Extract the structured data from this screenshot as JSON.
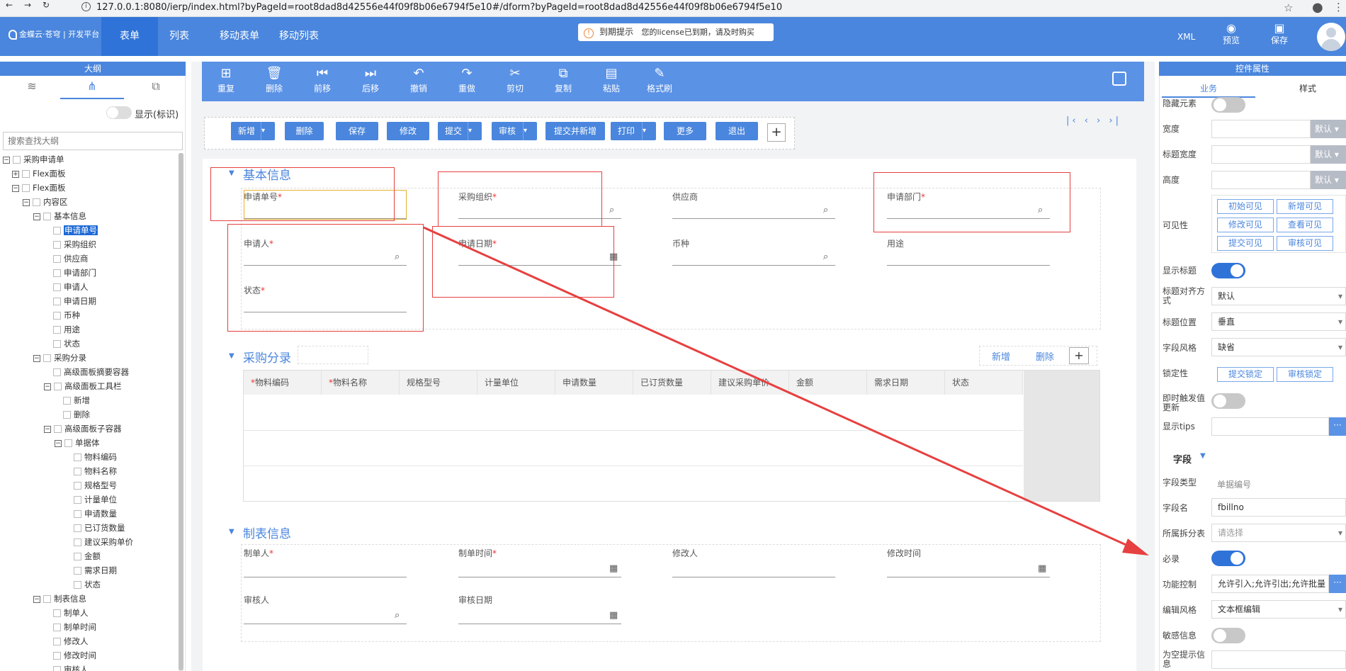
{
  "browser": {
    "url": "127.0.0.1:8080/ierp/index.html?byPageId=root8dad8d42556e44f09f8b06e6794f5e10#/dform?byPageId=root8dad8d42556e44f09f8b06e6794f5e10"
  },
  "header": {
    "logo_text": "金蝶云·苍穹 | 开发平台",
    "tabs": [
      "表单",
      "列表",
      "移动表单",
      "移动列表"
    ],
    "license_title": "到期提示",
    "license_message": "您的license已到期，请及时购买",
    "xml_label": "XML",
    "preview_label": "预览",
    "save_label": "保存"
  },
  "left_panel": {
    "title": "大纲",
    "show_id_label": "显示(标识)",
    "search_placeholder": "搜索查找大纲",
    "tree": [
      {
        "label": "采购申请单"
      },
      {
        "label": "Flex面板"
      },
      {
        "label": "Flex面板"
      },
      {
        "label": "内容区"
      },
      {
        "label": "基本信息"
      },
      {
        "label": "申请单号"
      },
      {
        "label": "采购组织"
      },
      {
        "label": "供应商"
      },
      {
        "label": "申请部门"
      },
      {
        "label": "申请人"
      },
      {
        "label": "申请日期"
      },
      {
        "label": "币种"
      },
      {
        "label": "用途"
      },
      {
        "label": "状态"
      },
      {
        "label": "采购分录"
      },
      {
        "label": "高级面板摘要容器"
      },
      {
        "label": "高级面板工具栏"
      },
      {
        "label": "新增"
      },
      {
        "label": "删除"
      },
      {
        "label": "高级面板子容器"
      },
      {
        "label": "单据体"
      },
      {
        "label": "物料编码"
      },
      {
        "label": "物料名称"
      },
      {
        "label": "规格型号"
      },
      {
        "label": "计量单位"
      },
      {
        "label": "申请数量"
      },
      {
        "label": "已订货数量"
      },
      {
        "label": "建议采购单价"
      },
      {
        "label": "金额"
      },
      {
        "label": "需求日期"
      },
      {
        "label": "状态"
      },
      {
        "label": "制表信息"
      },
      {
        "label": "制单人"
      },
      {
        "label": "制单时间"
      },
      {
        "label": "修改人"
      },
      {
        "label": "修改时间"
      },
      {
        "label": "审核人"
      }
    ]
  },
  "toolbar": {
    "items": [
      "重复",
      "删除",
      "前移",
      "后移",
      "撤销",
      "重做",
      "剪切",
      "复制",
      "粘贴",
      "格式刷"
    ]
  },
  "form_buttons": [
    "新增",
    "删除",
    "保存",
    "修改",
    "提交",
    "审核",
    "提交并新增",
    "打印",
    "更多",
    "退出"
  ],
  "pager": "|‹ ‹ › ›|",
  "sections": {
    "basic": {
      "title": "基本信息",
      "fields": [
        "申请单号",
        "采购组织",
        "供应商",
        "申请部门",
        "申请人",
        "申请日期",
        "币种",
        "用途",
        "状态"
      ]
    },
    "entry": {
      "title": "采购分录",
      "add_label": "新增",
      "delete_label": "删除",
      "plus_label": "+",
      "columns": [
        "物料编码",
        "物料名称",
        "规格型号",
        "计量单位",
        "申请数量",
        "已订货数量",
        "建议采购单价",
        "金额",
        "需求日期",
        "状态"
      ]
    },
    "audit": {
      "title": "制表信息",
      "fields": [
        "制单人",
        "制单时间",
        "修改人",
        "修改时间",
        "审核人",
        "审核日期"
      ]
    }
  },
  "right_panel": {
    "title": "控件属性",
    "tabs": [
      "业务",
      "样式"
    ],
    "labels": {
      "hidden": "隐藏元素",
      "width": "宽度",
      "title_width": "标题宽度",
      "height": "高度",
      "visibility": "可见性",
      "show_title": "显示标题",
      "title_align": "标题对齐方式",
      "title_position": "标题位置",
      "field_style": "字段风格",
      "lock": "锁定性",
      "instant_update": "即时触发值更新",
      "tips": "显示tips",
      "field_section": "字段",
      "field_type": "字段类型",
      "field_name": "字段名",
      "sub_table": "所属拆分表",
      "required": "必录",
      "function_control": "功能控制",
      "edit_style": "编辑风格",
      "sensitive": "敏感信息",
      "empty_tip": "为空提示信息"
    },
    "default_label": "默认",
    "visibility_buttons": [
      "初始可见",
      "新增可见",
      "修改可见",
      "查看可见",
      "提交可见",
      "审核可见"
    ],
    "lock_buttons": [
      "提交锁定",
      "审核锁定"
    ],
    "values": {
      "title_align": "默认",
      "title_position": "垂直",
      "field_style": "缺省",
      "field_type": "单据编号",
      "field_name": "fbillno",
      "sub_table": "请选择",
      "function_control": "允许引入;允许引出;允许批量",
      "edit_style": "文本框编辑",
      "ellipsis": "···"
    },
    "toggles": {
      "hidden": false,
      "show_title": true,
      "instant_update": false,
      "required": true,
      "sensitive": false
    }
  },
  "colors": {
    "header_blue": "#4a86dd",
    "annotation_red": "#e74040"
  }
}
